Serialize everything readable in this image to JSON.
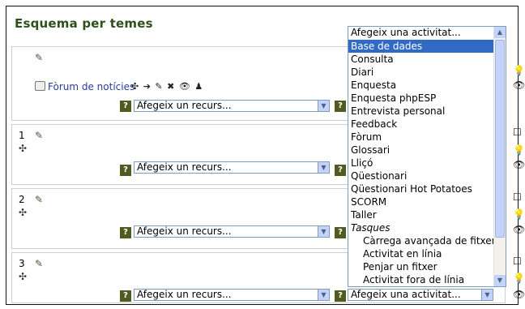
{
  "page": {
    "heading": "Esquema per temes"
  },
  "sections": [
    {
      "number": "",
      "resource_placeholder": "Afegeix un recurs...",
      "help": "?"
    },
    {
      "number": "1",
      "resource_placeholder": "Afegeix un recurs...",
      "help": "?"
    },
    {
      "number": "2",
      "resource_placeholder": "Afegeix un recurs...",
      "help": "?"
    },
    {
      "number": "3",
      "resource_placeholder": "Afegeix un recurs...",
      "help": "?"
    }
  ],
  "forum": {
    "label": "Fòrum de notícies"
  },
  "activity_dropdown": {
    "header": "Afegeix una activitat...",
    "selected_index": 0,
    "items": [
      "Base de dades",
      "Consulta",
      "Diari",
      "Enquesta",
      "Enquesta phpESP",
      "Entrevista personal",
      "Feedback",
      "Fòrum",
      "Glossari",
      "Lliçó",
      "Qüestionari",
      "Qüestionari Hot Potatoes",
      "SCORM",
      "Taller"
    ],
    "group_label": "Tasques",
    "group_items": [
      "Càrrega avançada de fitxers",
      "Activitat en línia",
      "Penjar un fitxer",
      "Activitat fora de línia"
    ],
    "closed_value": "Afegeix una activitat..."
  },
  "icons": {
    "edit": "pencil-icon",
    "move": "move-icon",
    "help": "help-icon",
    "highlight": "lightbulb-icon",
    "visibility": "eye-icon",
    "checkbox": "checkbox-icon"
  }
}
